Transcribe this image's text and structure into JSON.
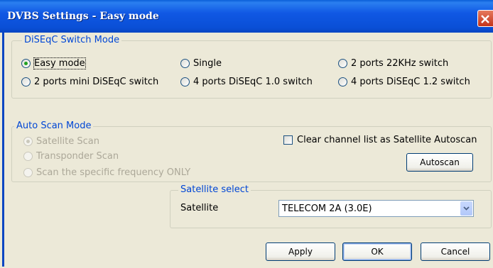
{
  "window": {
    "title": "DVBS Settings - Easy mode"
  },
  "diseqc": {
    "legend": "DiSEqC Switch Mode",
    "options": [
      {
        "label": "Easy mode",
        "selected": true
      },
      {
        "label": "Single",
        "selected": false
      },
      {
        "label": "2 ports 22KHz switch",
        "selected": false
      },
      {
        "label": "2 ports mini DiSEqC switch",
        "selected": false
      },
      {
        "label": "4 ports DiSEqC 1.0 switch",
        "selected": false
      },
      {
        "label": "4 ports DiSEqC 1.2 switch",
        "selected": false
      }
    ]
  },
  "autoscan": {
    "legend": "Auto Scan Mode",
    "options": [
      {
        "label": "Satellite Scan",
        "selected": true,
        "enabled": false
      },
      {
        "label": "Transponder Scan",
        "selected": false,
        "enabled": false
      },
      {
        "label": "Scan the specific frequency ONLY",
        "selected": false,
        "enabled": false
      }
    ],
    "clear_label": "Clear channel list as Satellite Autoscan",
    "clear_checked": false,
    "autoscan_button": "Autoscan"
  },
  "satellite": {
    "legend": "Satellite select",
    "label": "Satellite",
    "value": "TELECOM 2A (3.0E)"
  },
  "buttons": {
    "apply": "Apply",
    "ok": "OK",
    "cancel": "Cancel"
  }
}
